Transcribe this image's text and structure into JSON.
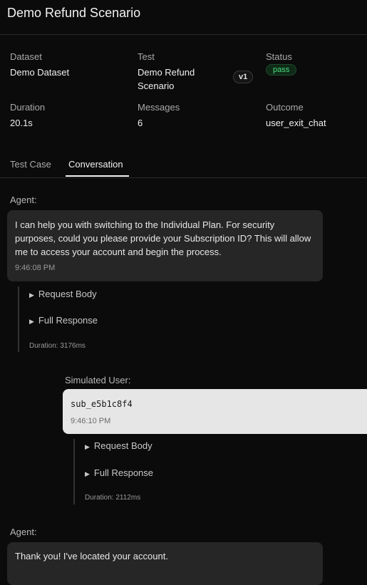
{
  "header": {
    "title": "Demo Refund Scenario"
  },
  "meta": {
    "dataset": {
      "label": "Dataset",
      "value": "Demo Dataset"
    },
    "test": {
      "label": "Test",
      "value": "Demo Refund Scenario",
      "version": "v1"
    },
    "status": {
      "label": "Status",
      "value": "pass",
      "color": "#4ade80"
    },
    "duration": {
      "label": "Duration",
      "value": "20.1s"
    },
    "messages": {
      "label": "Messages",
      "value": "6"
    },
    "outcome": {
      "label": "Outcome",
      "value": "user_exit_chat"
    }
  },
  "tabs": [
    {
      "label": "Test Case",
      "active": false
    },
    {
      "label": "Conversation",
      "active": true
    }
  ],
  "conversation": [
    {
      "sender": "Agent:",
      "text": "I can help you with switching to the Individual Plan. For security purposes, could you please provide your Subscription ID? This will allow me to access your account and begin the process.",
      "time": "9:46:08 PM",
      "request_body_label": "Request Body",
      "full_response_label": "Full Response",
      "duration": "Duration: 3176ms"
    },
    {
      "sender": "Simulated User:",
      "text": "sub_e5b1c8f4",
      "time": "9:46:10 PM",
      "request_body_label": "Request Body",
      "full_response_label": "Full Response",
      "duration": "Duration: 2112ms"
    },
    {
      "sender": "Agent:",
      "text": "Thank you! I've located your account."
    }
  ]
}
